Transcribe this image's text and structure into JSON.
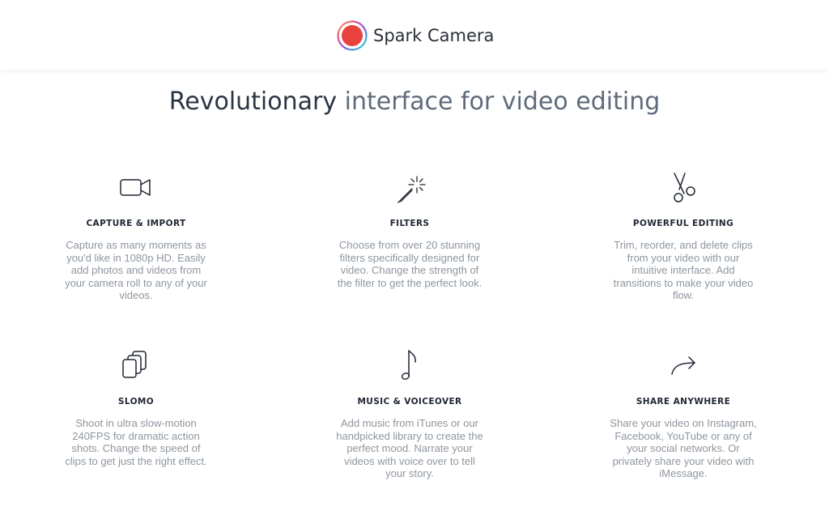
{
  "header": {
    "brand_name": "Spark Camera",
    "logo_icon": "spark-camera-logo-icon",
    "logo_color": "#e8423f"
  },
  "headline": {
    "bold": "Revolutionary",
    "light": "interface for video editing"
  },
  "features": [
    {
      "icon": "video-camera-icon",
      "title": "CAPTURE & IMPORT",
      "description": "Capture as many moments as you'd like in 1080p HD. Easily add photos and videos from your camera roll to any of your videos."
    },
    {
      "icon": "magic-wand-icon",
      "title": "FILTERS",
      "description": "Choose from over 20 stunning filters specifically designed for video. Change the strength of the filter to get the perfect look."
    },
    {
      "icon": "scissors-icon",
      "title": "POWERFUL EDITING",
      "description": "Trim, reorder, and delete clips from your video with our intuitive interface. Add transitions to make your video flow."
    },
    {
      "icon": "stacked-clips-icon",
      "title": "SLOMO",
      "description": "Shoot in ultra slow-motion 240FPS for dramatic action shots. Change the speed of clips to get just the right effect."
    },
    {
      "icon": "music-note-icon",
      "title": "MUSIC & VOICEOVER",
      "description": "Add music from iTunes or our handpicked library to create the perfect mood. Narrate your videos with voice over to tell your story."
    },
    {
      "icon": "share-arrow-icon",
      "title": "SHARE ANYWHERE",
      "description": "Share your video on Instagram, Facebook, YouTube or any of your social networks. Or privately share your video with iMessage."
    }
  ]
}
